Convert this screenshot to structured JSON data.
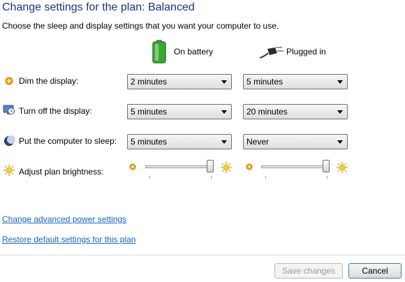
{
  "header": {
    "title": "Change settings for the plan: Balanced",
    "subtitle": "Choose the sleep and display settings that you want your computer to use."
  },
  "columns": {
    "battery": {
      "label": "On battery",
      "icon": "battery-icon"
    },
    "plugged": {
      "label": "Plugged in",
      "icon": "power-plug-icon"
    }
  },
  "rows": {
    "dim": {
      "label": "Dim the display:",
      "icon": "dim-display-icon",
      "battery": "2 minutes",
      "plugged": "5 minutes"
    },
    "off": {
      "label": "Turn off the display:",
      "icon": "monitor-clock-icon",
      "battery": "5 minutes",
      "plugged": "20 minutes"
    },
    "sleep": {
      "label": "Put the computer to sleep:",
      "icon": "moon-sleep-icon",
      "battery": "5 minutes",
      "plugged": "Never"
    },
    "brightness": {
      "label": "Adjust plan brightness:",
      "icon": "brightness-sun-icon",
      "battery_level": 1.0,
      "plugged_level": 1.0
    }
  },
  "links": {
    "advanced": "Change advanced power settings",
    "restore": "Restore default settings for this plan"
  },
  "buttons": {
    "save": "Save changes",
    "cancel": "Cancel"
  },
  "colors": {
    "title": "#1e3287",
    "link": "#1565c0",
    "battery_green": "#3fa535"
  }
}
